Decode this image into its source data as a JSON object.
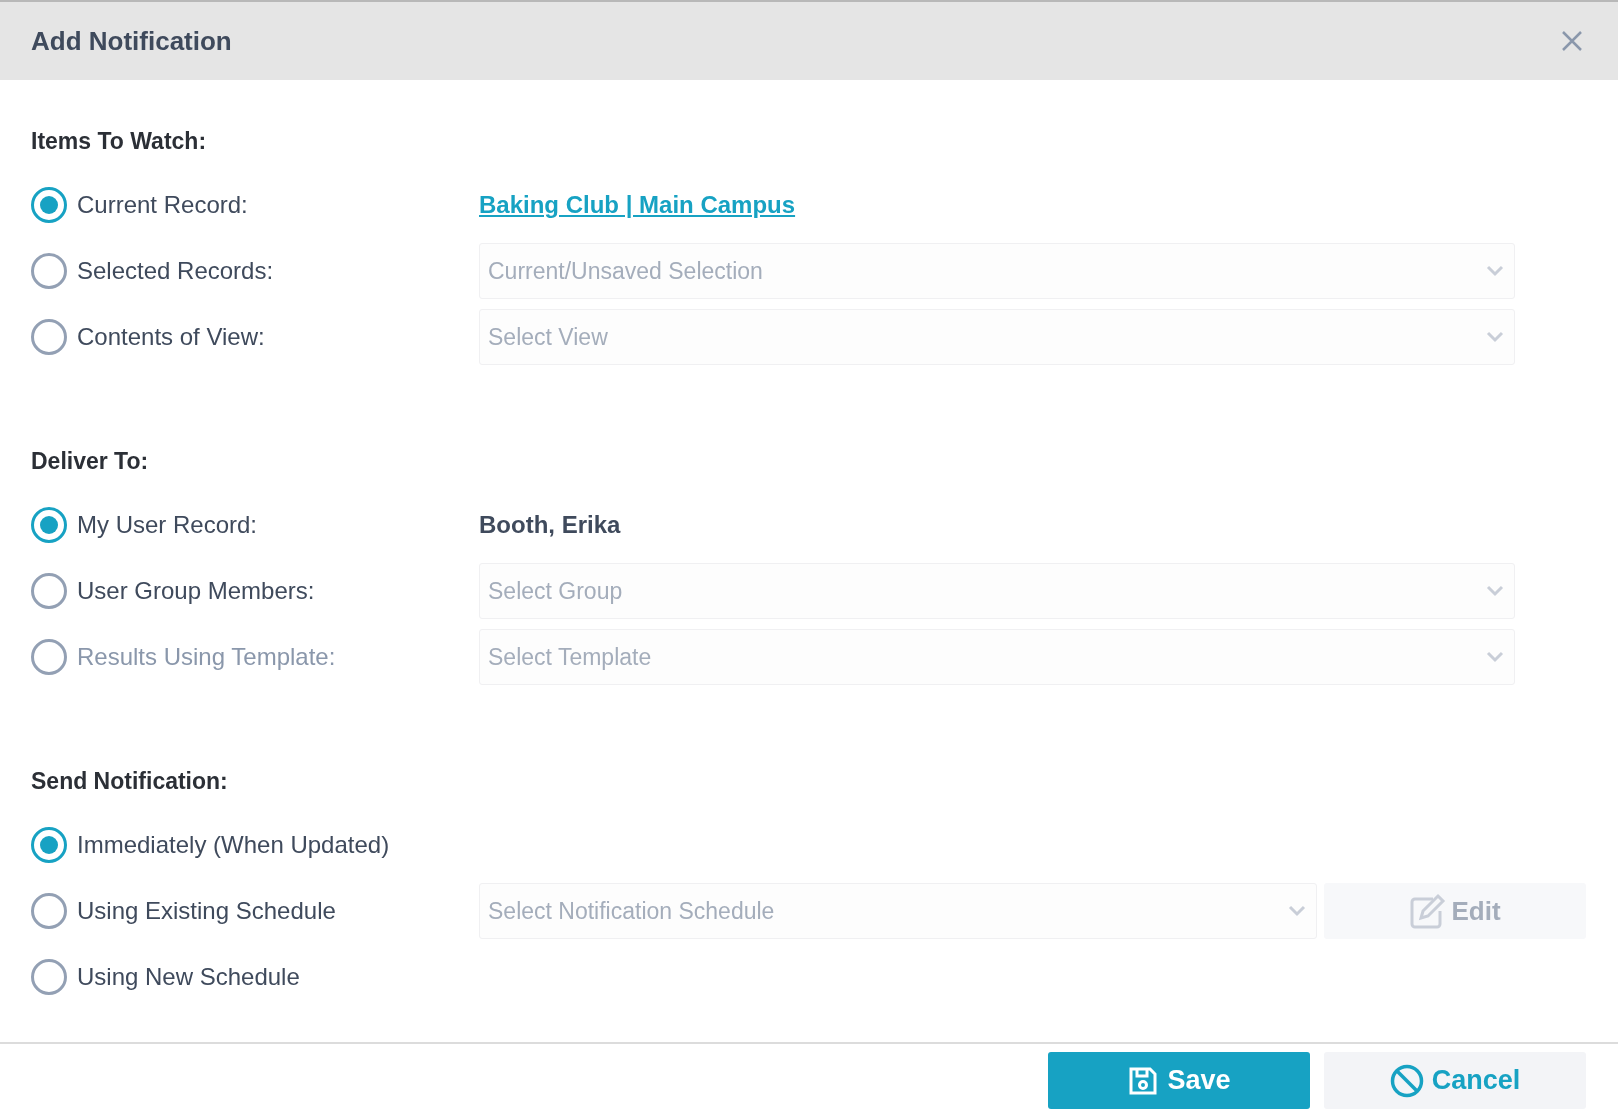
{
  "dialog": {
    "title": "Add Notification"
  },
  "sections": [
    {
      "heading": "Items To Watch:",
      "options": [
        {
          "label": "Current Record:",
          "selected": true,
          "disabled": false,
          "value": {
            "kind": "link",
            "text": "Baking Club | Main Campus"
          }
        },
        {
          "label": "Selected Records:",
          "selected": false,
          "disabled": false,
          "value": {
            "kind": "select",
            "placeholder": "Current/Unsaved Selection",
            "disabled": true
          }
        },
        {
          "label": "Contents of View:",
          "selected": false,
          "disabled": false,
          "value": {
            "kind": "select",
            "placeholder": "Select View",
            "disabled": true
          }
        }
      ]
    },
    {
      "heading": "Deliver To:",
      "options": [
        {
          "label": "My User Record:",
          "selected": true,
          "disabled": false,
          "value": {
            "kind": "text",
            "text": "Booth, Erika"
          }
        },
        {
          "label": "User Group Members:",
          "selected": false,
          "disabled": false,
          "value": {
            "kind": "select",
            "placeholder": "Select Group",
            "disabled": true
          }
        },
        {
          "label": "Results Using Template:",
          "selected": false,
          "disabled": true,
          "value": {
            "kind": "select",
            "placeholder": "Select Template",
            "disabled": true
          }
        }
      ]
    },
    {
      "heading": "Send Notification:",
      "options": [
        {
          "label": "Immediately (When Updated)",
          "selected": true,
          "disabled": false
        },
        {
          "label": "Using Existing Schedule",
          "selected": false,
          "disabled": false,
          "value": {
            "kind": "select_edit",
            "placeholder": "Select Notification Schedule",
            "disabled": true,
            "edit_button": {
              "label": "Edit",
              "disabled": true
            }
          }
        },
        {
          "label": "Using New Schedule",
          "selected": false,
          "disabled": false
        }
      ]
    }
  ],
  "footer_buttons": [
    {
      "kind": "primary",
      "label": "Save"
    },
    {
      "kind": "secondary",
      "label": "Cancel"
    }
  ]
}
